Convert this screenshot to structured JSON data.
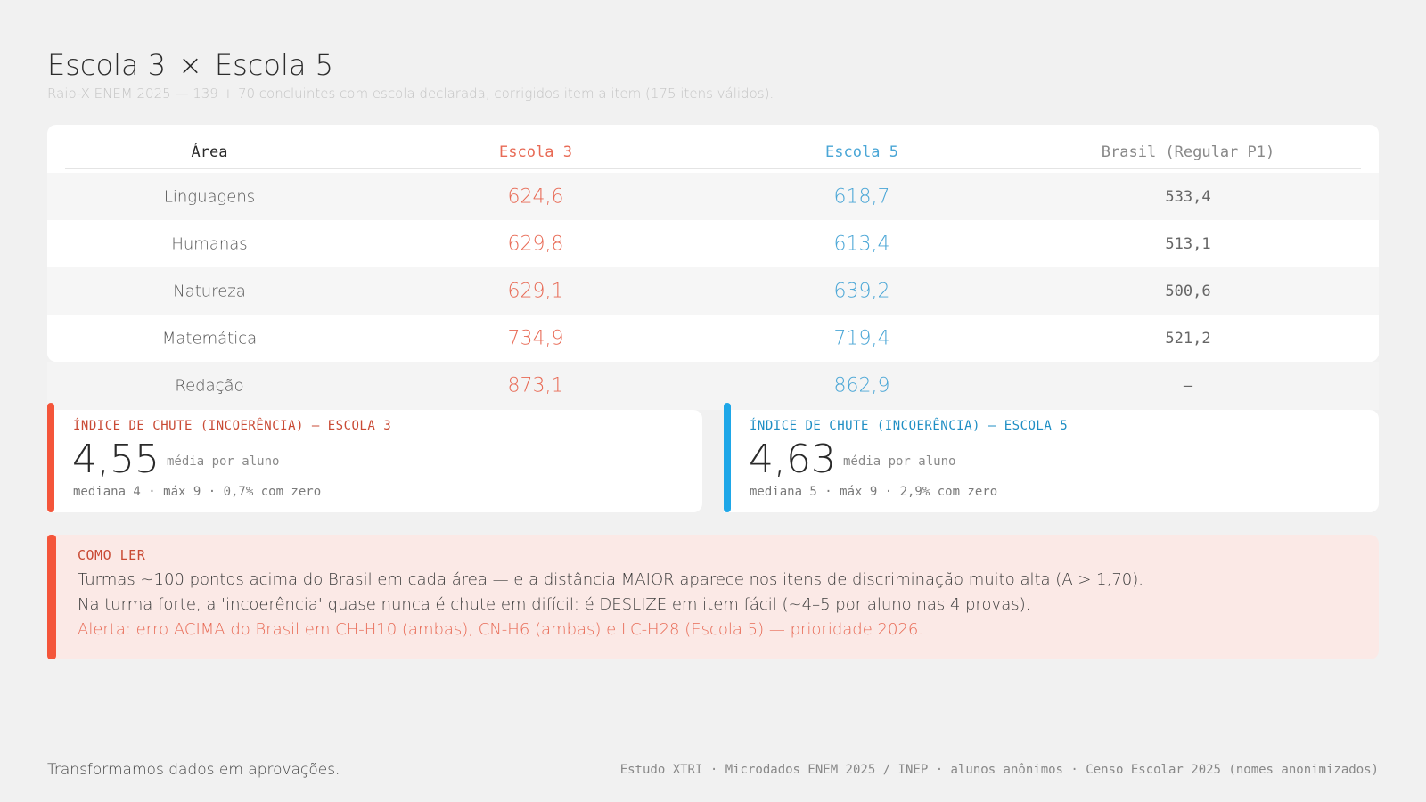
{
  "header": {
    "title_left": "Escola 3",
    "title_sep": "×",
    "title_right": "Escola 5",
    "subtitle": "Raio-X ENEM 2025 — 139 + 70 concluintes com escola declarada, corrigidos item a item (175 itens válidos)."
  },
  "table": {
    "columns": [
      "Área",
      "Escola 3",
      "Escola 5",
      "Brasil (Regular P1)"
    ],
    "rows": [
      [
        "Linguagens",
        "624,6",
        "618,7",
        "533,4"
      ],
      [
        "Humanas",
        "629,8",
        "613,4",
        "513,1"
      ],
      [
        "Natureza",
        "629,1",
        "639,2",
        "500,6"
      ],
      [
        "Matemática",
        "734,9",
        "719,4",
        "521,2"
      ],
      [
        "Redação",
        "873,1",
        "862,9",
        "—"
      ]
    ]
  },
  "index_cards": [
    {
      "label": "ÍNDICE DE CHUTE (INCOERÊNCIA) — ESCOLA 3",
      "value": "4,55",
      "unit": "média por aluno",
      "stats": "mediana 4 · máx 9 · 0,7% com zero",
      "color": "#f4553a"
    },
    {
      "label": "ÍNDICE DE CHUTE (INCOERÊNCIA) — ESCOLA 5",
      "value": "4,63",
      "unit": "média por aluno",
      "stats": "mediana 5 · máx 9 · 2,9% com zero",
      "color": "#1ea7e8"
    }
  ],
  "note": {
    "title": "COMO LER",
    "line1": "Turmas ~100 pontos acima do Brasil em cada área — e a distância MAIOR aparece nos itens de discriminação muito alta (A > 1,70).",
    "line2": "Na turma forte, a 'incoerência' quase nunca é chute em difícil: é DESLIZE em item fácil (~4–5 por aluno nas 4 provas).",
    "alert": "Alerta: erro ACIMA do Brasil em CH-H10 (ambas), CN-H6 (ambas) e LC-H28 (Escola 5) — prioridade 2026."
  },
  "footer": {
    "tagline": "Transformamos dados em aprovações.",
    "source": "Estudo XTRI · Microdados ENEM 2025 / INEP · alunos anônimos · Censo Escolar 2025 (nomes anonimizados)"
  },
  "colors": {
    "escola3": "#e86a55",
    "escola5": "#4aa6d6",
    "accent_red": "#f4553a",
    "accent_blue": "#1ea7e8"
  }
}
